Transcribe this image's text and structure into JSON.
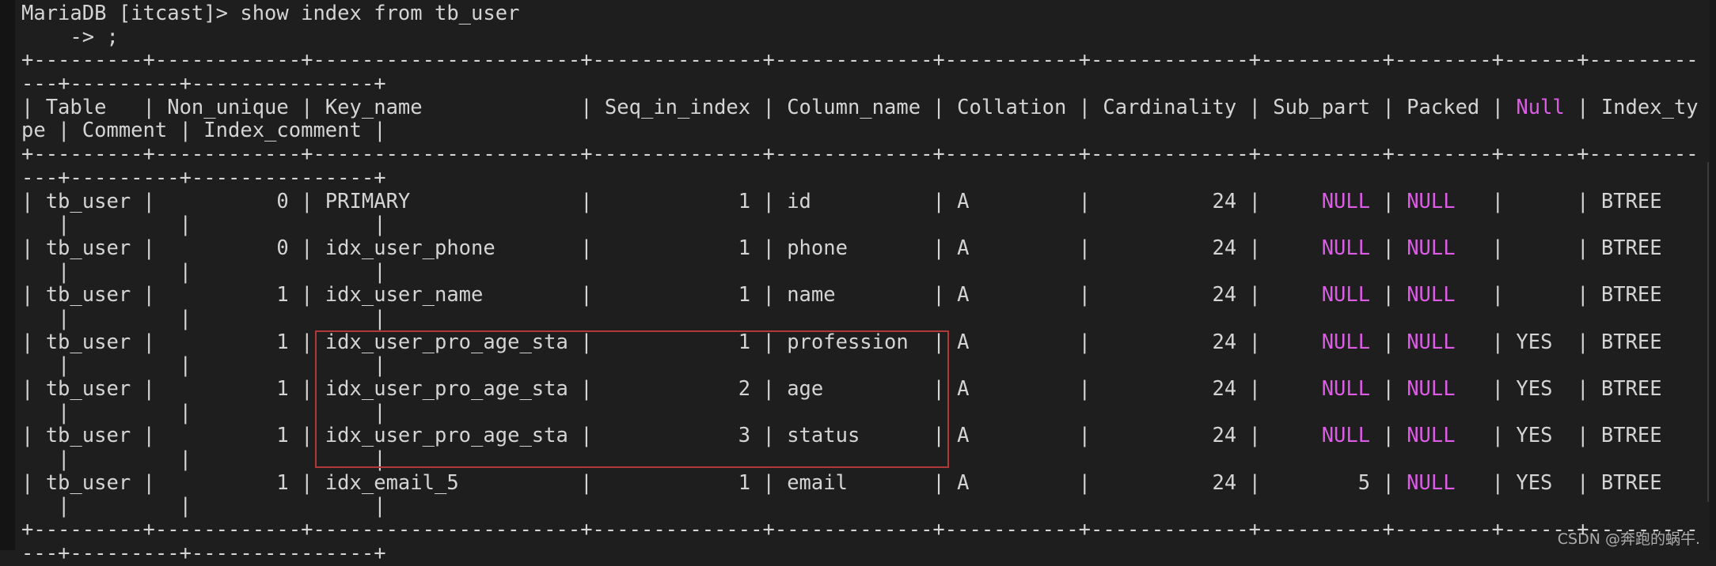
{
  "terminal": {
    "prompt": "MariaDB [itcast]> ",
    "command": "show index from tb_user",
    "continuation": "    -> ;",
    "wrap_columns": 138
  },
  "table": {
    "columns": [
      "Table",
      "Non_unique",
      "Key_name",
      "Seq_in_index",
      "Column_name",
      "Collation",
      "Cardinality",
      "Sub_part",
      "Packed",
      "Null",
      "Index_type",
      "Comment",
      "Index_comment"
    ],
    "widths": [
      7,
      10,
      20,
      12,
      11,
      9,
      11,
      8,
      6,
      4,
      10,
      7,
      13
    ],
    "align": [
      "left",
      "right",
      "left",
      "right",
      "left",
      "left",
      "right",
      "right",
      "left",
      "left",
      "left",
      "left",
      "left"
    ],
    "highlight_header": [
      "Null"
    ],
    "null_value": "NULL",
    "rows": [
      [
        "tb_user",
        "0",
        "PRIMARY",
        "1",
        "id",
        "A",
        "24",
        "NULL",
        "NULL",
        "",
        "BTREE",
        "",
        ""
      ],
      [
        "tb_user",
        "0",
        "idx_user_phone",
        "1",
        "phone",
        "A",
        "24",
        "NULL",
        "NULL",
        "",
        "BTREE",
        "",
        ""
      ],
      [
        "tb_user",
        "1",
        "idx_user_name",
        "1",
        "name",
        "A",
        "24",
        "NULL",
        "NULL",
        "",
        "BTREE",
        "",
        ""
      ],
      [
        "tb_user",
        "1",
        "idx_user_pro_age_sta",
        "1",
        "profession",
        "A",
        "24",
        "NULL",
        "NULL",
        "YES",
        "BTREE",
        "",
        ""
      ],
      [
        "tb_user",
        "1",
        "idx_user_pro_age_sta",
        "2",
        "age",
        "A",
        "24",
        "NULL",
        "NULL",
        "YES",
        "BTREE",
        "",
        ""
      ],
      [
        "tb_user",
        "1",
        "idx_user_pro_age_sta",
        "3",
        "status",
        "A",
        "24",
        "NULL",
        "NULL",
        "YES",
        "BTREE",
        "",
        ""
      ],
      [
        "tb_user",
        "1",
        "idx_email_5",
        "1",
        "email",
        "A",
        "24",
        "5",
        "NULL",
        "YES",
        "BTREE",
        "",
        ""
      ]
    ],
    "highlighted_rows": [
      3,
      4,
      5
    ]
  },
  "colors": {
    "background": "#1e1e1e",
    "text": "#d4d4d4",
    "null_highlight": "#dc5ce6",
    "annotation_box": "#b03a3a"
  },
  "watermark": "CSDN @奔跑的蜗牛."
}
